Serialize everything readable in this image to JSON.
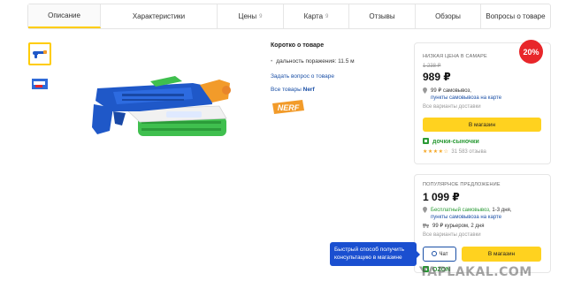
{
  "tabs": [
    {
      "label": "Описание",
      "count": "",
      "active": true
    },
    {
      "label": "Характеристики",
      "count": ""
    },
    {
      "label": "Цены",
      "count": "9"
    },
    {
      "label": "Карта",
      "count": "9"
    },
    {
      "label": "Отзывы",
      "count": ""
    },
    {
      "label": "Обзоры",
      "count": ""
    },
    {
      "label": "Вопросы о товаре",
      "count": ""
    }
  ],
  "info": {
    "title": "Коротко о товаре",
    "spec": "дальность поражения: 11.5 м",
    "ask_link": "Задать вопрос о товаре",
    "all_prefix": "Все товары",
    "all_brand": "Nerf",
    "brand_logo_text": "NERF"
  },
  "offer1": {
    "label": "НИЗКАЯ ЦЕНА В САМАРЕ",
    "badge": "20%",
    "old_price": "1 238 ₽",
    "price": "989 ₽",
    "delivery_text": "99 ₽ самовывоз,",
    "delivery_link": "пункты самовывоза на карте",
    "variants": "Все варианты доставки",
    "button": "В магазин",
    "shop": "дочки-сыночки",
    "rating_stars": "★★★★☆",
    "reviews": "31 583 отзыва"
  },
  "offer2": {
    "label": "ПОПУЛЯРНОЕ ПРЕДЛОЖЕНИЕ",
    "price": "1 099 ₽",
    "pickup_green": "Бесплатный самовывоз,",
    "pickup_days": "1-3 дня,",
    "pickup_link": "пункты самовывоза на карте",
    "courier": "99 ₽ курьером, 2 дня",
    "variants": "Все варианты доставки",
    "chat_button": "Чат",
    "button": "В магазин",
    "shop": "OZON"
  },
  "tooltip": "Быстрый способ получить консультацию в магазине",
  "watermark": "YAPLAKAL.COM",
  "colors": {
    "accent_yellow": "#ffd21f",
    "link_blue": "#1a4fa6",
    "sale_red": "#e8262a",
    "shop_green": "#2a9a35"
  }
}
